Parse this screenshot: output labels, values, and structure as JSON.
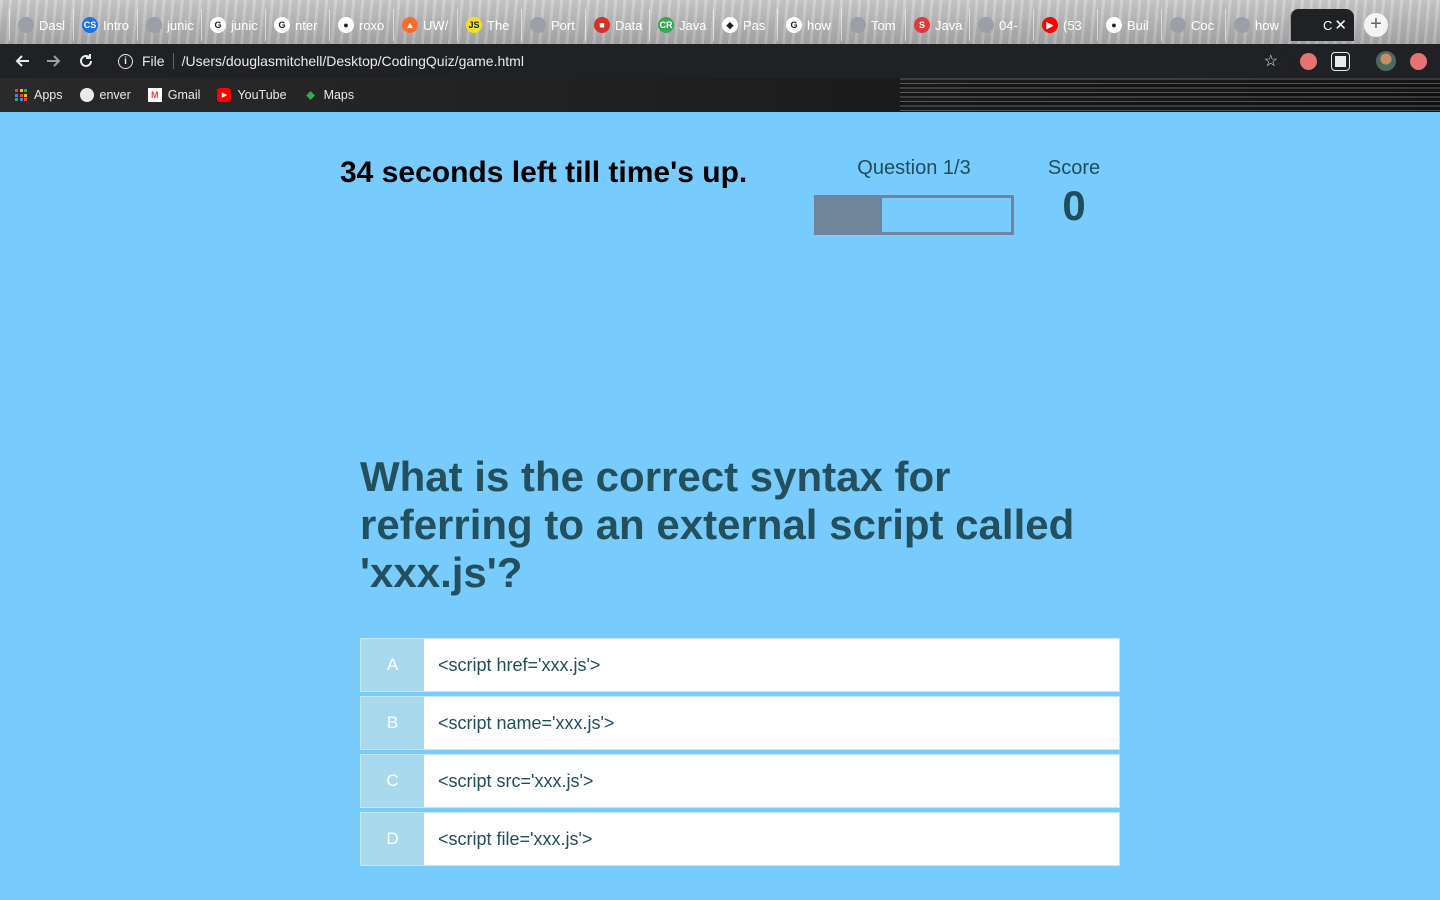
{
  "browser": {
    "tabs": [
      {
        "label": "Dasl",
        "icon": "globe-icon",
        "color": "#9aa0a6"
      },
      {
        "label": "Intro",
        "icon": "cs-icon",
        "color": "#1a73e8"
      },
      {
        "label": "junic",
        "icon": "globe-icon",
        "color": "#9aa0a6"
      },
      {
        "label": "junic",
        "icon": "google-icon",
        "color": "#ffffff"
      },
      {
        "label": "nter",
        "icon": "google-icon",
        "color": "#ffffff"
      },
      {
        "label": "roxo",
        "icon": "github-icon",
        "color": "#ffffff"
      },
      {
        "label": "UW/",
        "icon": "gitlab-icon",
        "color": "#fc6d26"
      },
      {
        "label": "The",
        "icon": "js-icon",
        "color": "#f7df1e"
      },
      {
        "label": "Port",
        "icon": "globe-icon",
        "color": "#9aa0a6"
      },
      {
        "label": "Data",
        "icon": "data-icon",
        "color": "#d93025"
      },
      {
        "label": "Java",
        "icon": "cr-icon",
        "color": "#34a853"
      },
      {
        "label": "Pas",
        "icon": "codepen-icon",
        "color": "#ffffff"
      },
      {
        "label": "how",
        "icon": "google-icon",
        "color": "#ffffff"
      },
      {
        "label": "Tom",
        "icon": "globe-icon",
        "color": "#9aa0a6"
      },
      {
        "label": "Java",
        "icon": "w3-icon",
        "color": "#e53935"
      },
      {
        "label": "04-",
        "icon": "globe-icon",
        "color": "#9aa0a6"
      },
      {
        "label": "(53",
        "icon": "youtube-icon",
        "color": "#ff0000"
      },
      {
        "label": "Buil",
        "icon": "github-icon",
        "color": "#ffffff"
      },
      {
        "label": "Coc",
        "icon": "globe-icon",
        "color": "#9aa0a6"
      },
      {
        "label": "how",
        "icon": "globe-icon",
        "color": "#9aa0a6"
      }
    ],
    "active_tab_label": "C",
    "new_tab_symbol": "+",
    "file_label": "File",
    "url": "/Users/douglasmitchell/Desktop/CodingQuiz/game.html",
    "bookmarks": [
      {
        "label": "Apps",
        "icon": "apps-grid-icon"
      },
      {
        "label": "enver",
        "icon": "globe-icon"
      },
      {
        "label": "Gmail",
        "icon": "gmail-icon"
      },
      {
        "label": "YouTube",
        "icon": "youtube-icon"
      },
      {
        "label": "Maps",
        "icon": "maps-icon"
      }
    ]
  },
  "quiz": {
    "timer_text": "34 seconds left till time's up.",
    "question_counter": "Question 1/3",
    "progress_fraction": 0.333,
    "score_label": "Score",
    "score_value": "0",
    "question": "What is the correct syntax for referring to an external script called 'xxx.js'?",
    "answers": [
      {
        "letter": "A",
        "text": "<script href='xxx.js'>"
      },
      {
        "letter": "B",
        "text": "<script name='xxx.js'>"
      },
      {
        "letter": "C",
        "text": "<script src='xxx.js'>"
      },
      {
        "letter": "D",
        "text": "<script file='xxx.js'>"
      }
    ]
  },
  "colors": {
    "page_background": "#78cbfd",
    "progress_fill": "#71859a",
    "heading_text": "#23505c",
    "answer_letter_bg": "#a9d9ec"
  }
}
